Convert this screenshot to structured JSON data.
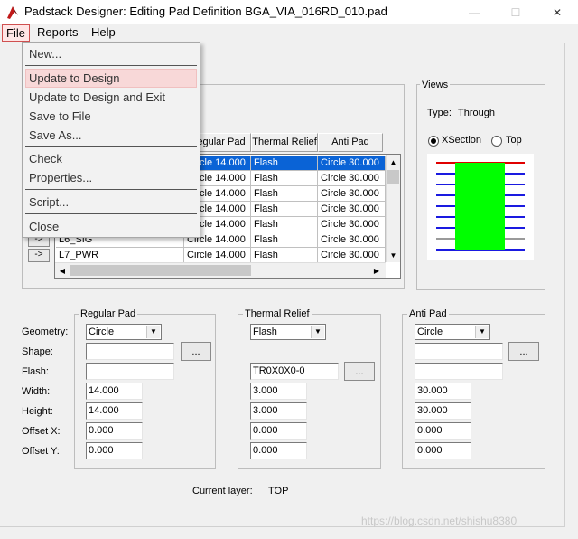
{
  "window": {
    "title": "Padstack Designer: Editing Pad Definition BGA_VIA_016RD_010.pad",
    "minimize_glyph": "—",
    "maximize_glyph": "☐",
    "close_glyph": "✕"
  },
  "menubar": {
    "file": "File",
    "reports": "Reports",
    "help": "Help"
  },
  "file_menu": {
    "items": [
      "New...",
      "Update to Design",
      "Update to Design and Exit",
      "Save to File",
      "Save As...",
      "Check",
      "Properties...",
      "Script...",
      "Close"
    ],
    "highlighted": "Update to Design"
  },
  "table": {
    "headers": [
      "Regular Pad",
      "Thermal Relief",
      "Anti Pad"
    ],
    "rows": [
      {
        "button": "",
        "layer": "",
        "regular": "Circle 14.000",
        "thermal": "Flash",
        "anti": "Circle 30.000"
      },
      {
        "button": "",
        "layer": "",
        "regular": "Circle 14.000",
        "thermal": "Flash",
        "anti": "Circle 30.000"
      },
      {
        "button": "",
        "layer": "",
        "regular": "Circle 14.000",
        "thermal": "Flash",
        "anti": "Circle 30.000"
      },
      {
        "button": "",
        "layer": "",
        "regular": "Circle 14.000",
        "thermal": "Flash",
        "anti": "Circle 30.000"
      },
      {
        "button": "",
        "layer": "",
        "regular": "Circle 14.000",
        "thermal": "Flash",
        "anti": "Circle 30.000"
      },
      {
        "button": "->",
        "layer": "L6_SIG",
        "regular": "Circle 14.000",
        "thermal": "Flash",
        "anti": "Circle 30.000"
      },
      {
        "button": "->",
        "layer": "L7_PWR",
        "regular": "Circle 14.000",
        "thermal": "Flash",
        "anti": "Circle 30.000"
      }
    ],
    "selected_row": 0
  },
  "views": {
    "title": "Views",
    "type_label": "Type:",
    "type_value": "Through",
    "xsection_label": "XSection",
    "top_label": "Top",
    "selected": "xsection",
    "pad_color": "#00ff00",
    "top_line_color": "#e00000",
    "inner_line_color": "#1a1ae0",
    "plane_line_color": "#9a9a9a"
  },
  "labels": {
    "geometry": "Geometry:",
    "shape": "Shape:",
    "flash": "Flash:",
    "width": "Width:",
    "height": "Height:",
    "offset_x": "Offset X:",
    "offset_y": "Offset Y:",
    "browse": "..."
  },
  "regular_pad": {
    "title": "Regular Pad",
    "geometry": "Circle",
    "shape": "",
    "flash": "",
    "width": "14.000",
    "height": "14.000",
    "offset_x": "0.000",
    "offset_y": "0.000"
  },
  "thermal_relief": {
    "title": "Thermal Relief",
    "geometry": "Flash",
    "flash": "TR0X0X0-0",
    "width": "3.000",
    "height": "3.000",
    "offset_x": "0.000",
    "offset_y": "0.000"
  },
  "anti_pad": {
    "title": "Anti Pad",
    "geometry": "Circle",
    "shape": "",
    "flash": "",
    "width": "30.000",
    "height": "30.000",
    "offset_x": "0.000",
    "offset_y": "0.000"
  },
  "status": {
    "current_layer_label": "Current layer:",
    "current_layer_value": "TOP"
  },
  "watermark": "https://blog.csdn.net/shishu8380"
}
